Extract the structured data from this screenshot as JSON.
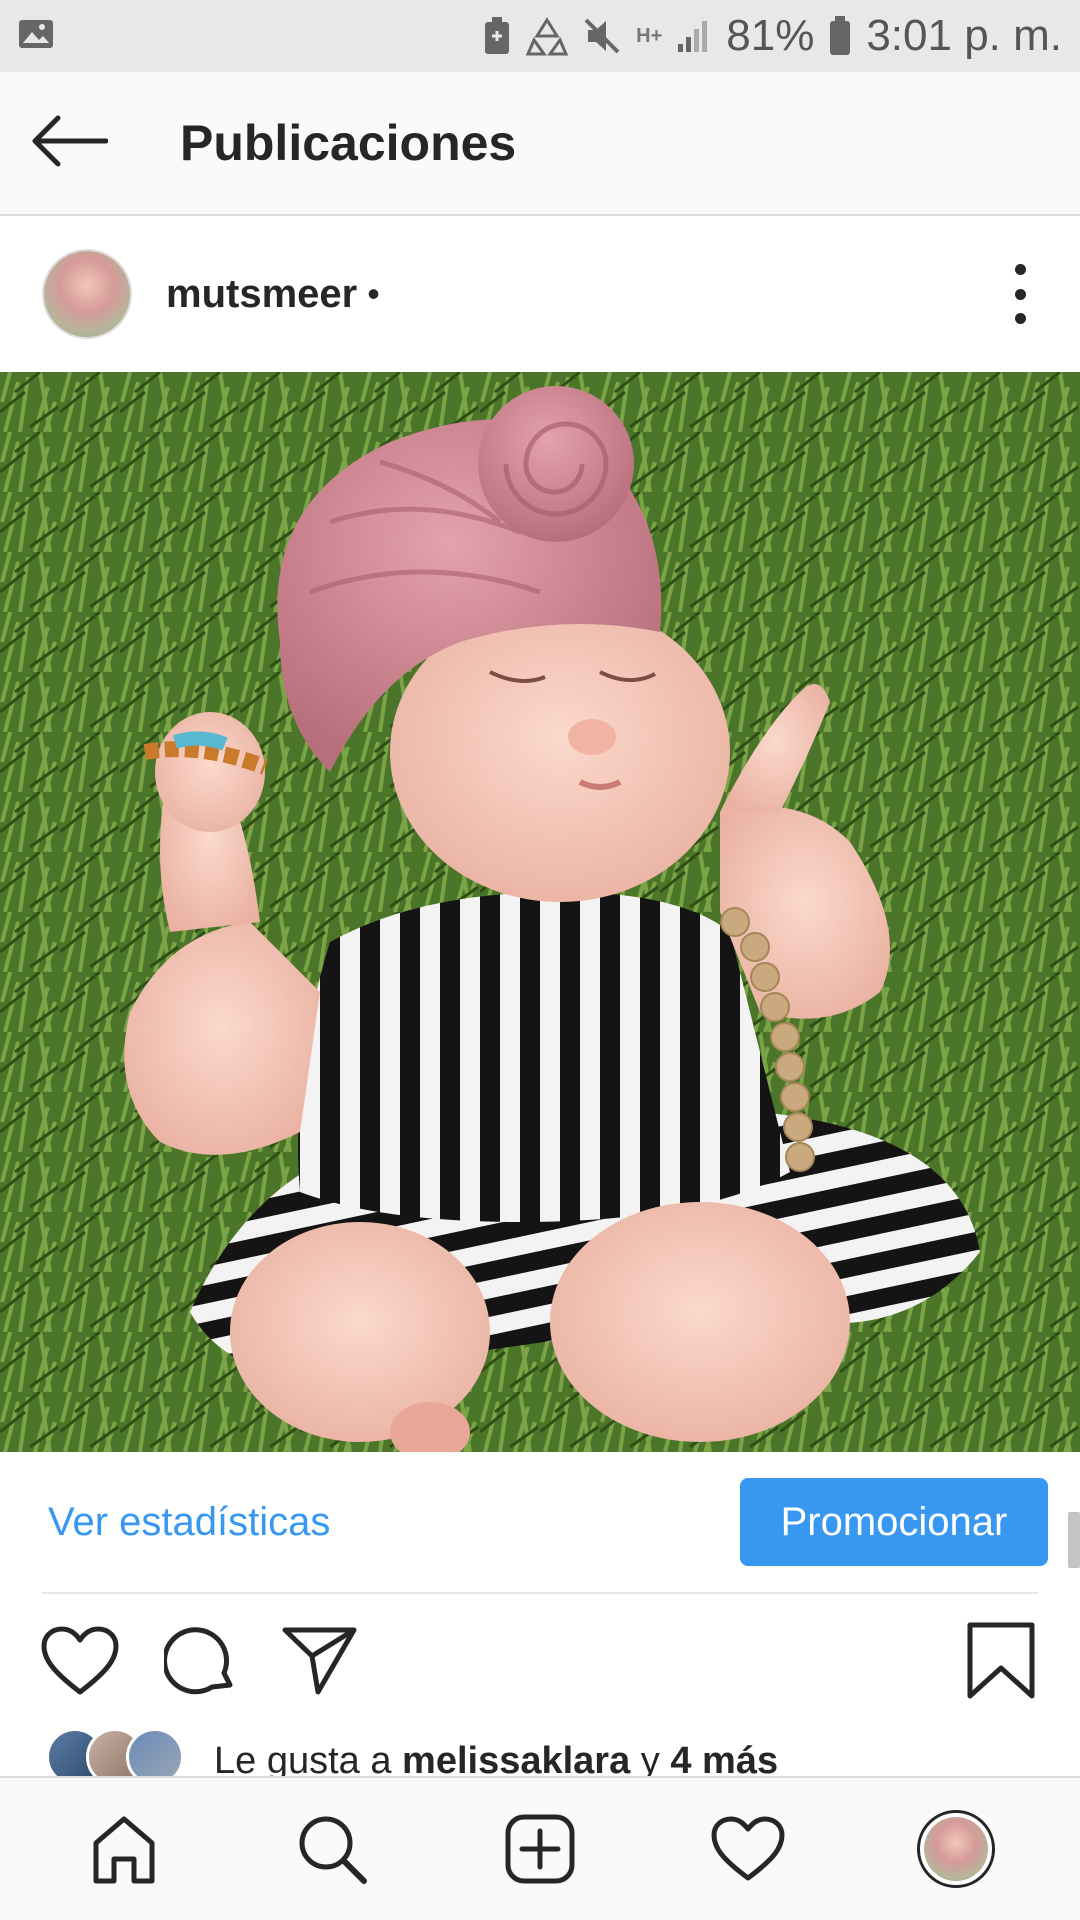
{
  "status_bar": {
    "battery_percent": "81%",
    "time": "3:01 p. m.",
    "network": "H+",
    "icons": [
      "image-icon",
      "battery-saver-icon",
      "recycle-icon",
      "mute-icon",
      "network-icon",
      "signal-icon",
      "battery-icon"
    ]
  },
  "header": {
    "title": "Publicaciones",
    "back_icon": "arrow-left-icon"
  },
  "post": {
    "username": "mutsmeer",
    "dot": "•",
    "more_icon": "more-vertical-icon",
    "photo_description": "baby sleeping on grass wearing pink turban and black-white striped romper",
    "insights_label": "Ver estadísticas",
    "promote_label": "Promocionar",
    "actions": [
      "heart-icon",
      "comment-icon",
      "share-icon",
      "bookmark-icon"
    ],
    "likes": {
      "prefix": "Le gusta a ",
      "user": "melissaklara",
      "connector": " y ",
      "others": "4 más"
    }
  },
  "bottom_nav": {
    "items": [
      "home-icon",
      "search-icon",
      "add-icon",
      "activity-icon",
      "profile-avatar"
    ]
  },
  "colors": {
    "accent": "#3897f0",
    "text": "#262626",
    "grass": "#4f7a2c",
    "turban": "#d38f9a"
  }
}
